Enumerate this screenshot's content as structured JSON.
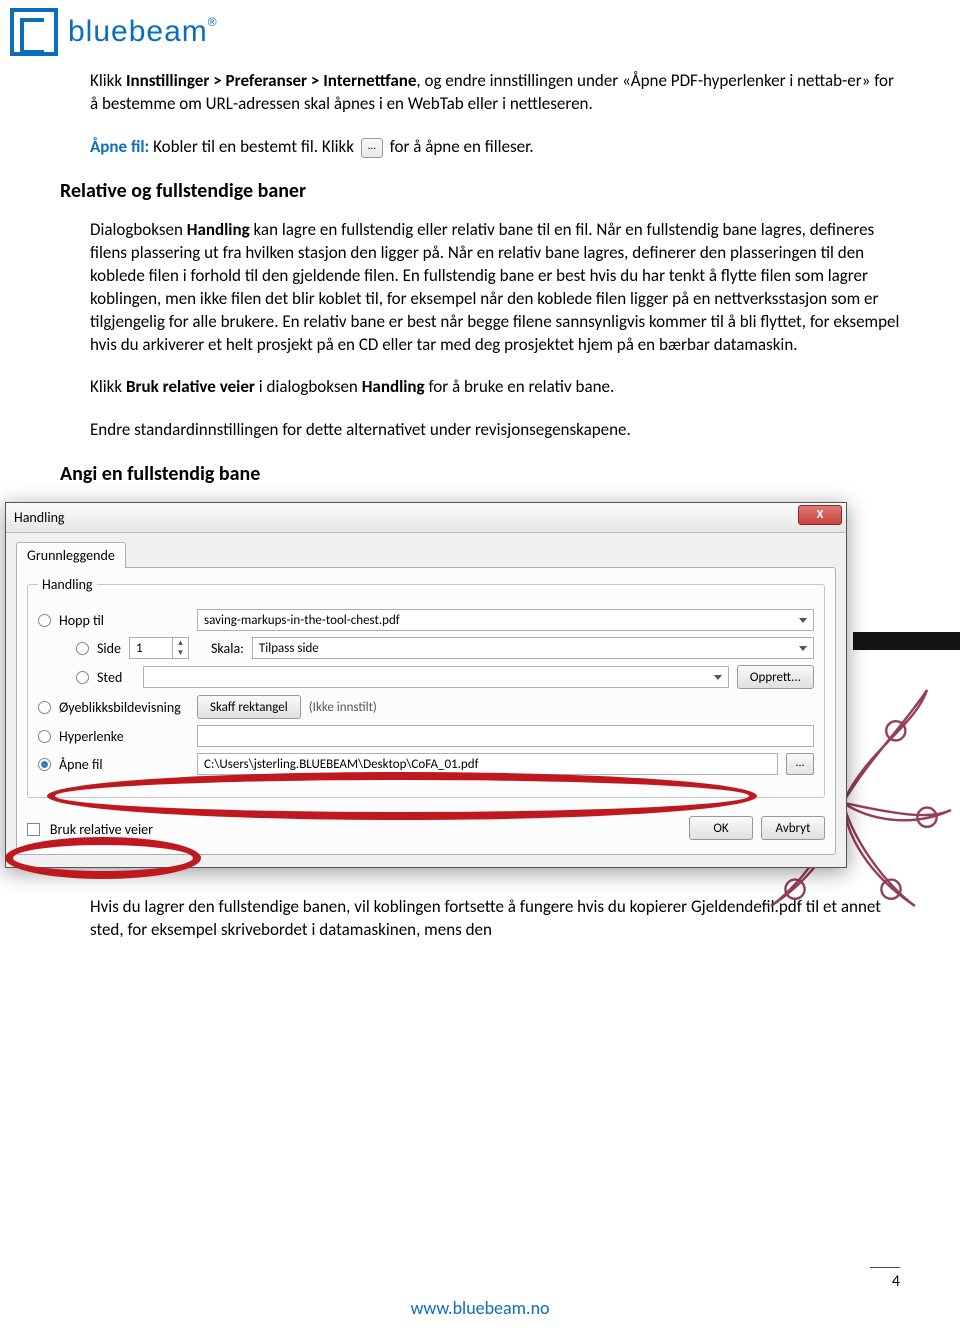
{
  "logo": {
    "brand": "bluebeam",
    "reg": "®"
  },
  "p1": {
    "pre": "Klikk ",
    "bold1": "Innstillinger > Preferanser > Internettfane",
    "post": ", og endre innstillingen under «Åpne PDF-hyperlenker i nettab-er» for å bestemme om URL-adressen skal åpnes i en WebTab eller i nettleseren."
  },
  "p2": {
    "pre": "Åpne fil:",
    "mid": " Kobler til en bestemt fil. Klikk ",
    "post": " for å åpne en filleser.",
    "btn": "..."
  },
  "h1": "Relative og fullstendige baner",
  "p3": {
    "pre": "Dialogboksen ",
    "bold1": "Handling",
    "body": " kan lagre en fullstendig eller relativ bane til en fil. Når en fullstendig bane lagres, defineres filens plassering ut fra hvilken stasjon den ligger på. Når en relativ bane lagres, definerer den plasseringen til den koblede filen i forhold til den gjeldende filen. En fullstendig bane er best hvis du har tenkt å flytte filen som lagrer koblingen, men ikke filen det blir koblet til, for eksempel når den koblede filen ligger på en nettverksstasjon som er tilgjengelig for alle brukere. En relativ bane er best når begge filene sannsynligvis kommer til å bli flyttet, for eksempel hvis du arkiverer et helt prosjekt på en CD eller tar med deg prosjektet hjem på en bærbar datamaskin."
  },
  "p4": {
    "t1": "Klikk ",
    "b1": "Bruk relative veier",
    "t2": " i dialogboksen ",
    "b2": "Handling",
    "t3": " for å bruke en relativ bane."
  },
  "p5": "Endre standardinnstillingen for dette alternativet under revisjonsegenskapene.",
  "h2": "Angi en fullstendig bane",
  "dialog": {
    "title": "Handling",
    "close": "X",
    "tab": "Grunnleggende",
    "group_label": "Handling",
    "hopp_til": "Hopp til",
    "hopp_val": "saving-markups-in-the-tool-chest.pdf",
    "side": "Side",
    "side_val": "1",
    "skala": "Skala:",
    "skala_val": "Tilpass side",
    "sted": "Sted",
    "opprett": "Opprett...",
    "snapshot": "Øyeblikksbildevisning",
    "skaff": "Skaff rektangel",
    "not_set": "(Ikke innstilt)",
    "hyperlink": "Hyperlenke",
    "open_file": "Åpne fil",
    "file_path": "C:\\Users\\jsterling.BLUEBEAM\\Desktop\\CoFA_01.pdf",
    "browse": "...",
    "use_relative": "Bruk relative veier",
    "ok": "OK",
    "cancel": "Avbryt"
  },
  "p6": "Hvis du lagrer den fullstendige banen, vil koblingen fortsette å fungere hvis du kopierer Gjeldendefil.pdf til et annet sted, for eksempel skrivebordet i datamaskinen, mens den",
  "footer_url": "www.bluebeam.no",
  "page_num": "4"
}
